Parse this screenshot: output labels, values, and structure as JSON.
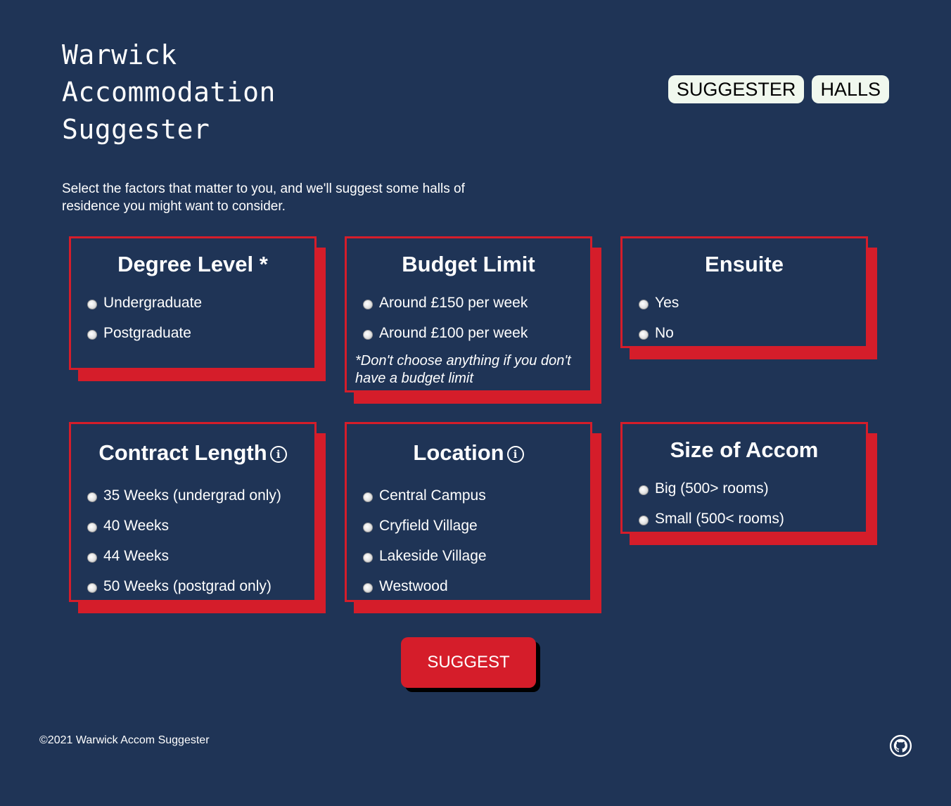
{
  "header": {
    "title": "Warwick Accommodation Suggester",
    "nav": [
      "SUGGESTER",
      "HALLS"
    ]
  },
  "intro": "Select the factors that matter to you, and we'll suggest some halls of residence you might want to consider.",
  "cards": {
    "degree": {
      "title": "Degree Level *",
      "options": [
        "Undergraduate",
        "Postgraduate"
      ]
    },
    "budget": {
      "title": "Budget Limit",
      "options": [
        "Around £150 per week",
        "Around £100 per week"
      ],
      "note": "*Don't choose anything if you don't have a budget limit"
    },
    "ensuite": {
      "title": "Ensuite",
      "options": [
        "Yes",
        "No"
      ]
    },
    "contract": {
      "title": "Contract Length",
      "options": [
        "35 Weeks (undergrad only)",
        "40 Weeks",
        "44 Weeks",
        "50 Weeks (postgrad only)"
      ]
    },
    "location": {
      "title": "Location",
      "options": [
        "Central Campus",
        "Cryfield Village",
        "Lakeside Village",
        "Westwood"
      ]
    },
    "size": {
      "title": "Size of Accom",
      "options": [
        "Big (500> rooms)",
        "Small (500< rooms)"
      ]
    }
  },
  "info_glyph": "i",
  "suggest_label": "SUGGEST",
  "footer": {
    "copyright": "©2021 Warwick Accom Suggester",
    "icon": "github-icon"
  },
  "colors": {
    "background": "#1f3456",
    "accent": "#d51d2a",
    "nav_button": "#f0f8ee"
  }
}
